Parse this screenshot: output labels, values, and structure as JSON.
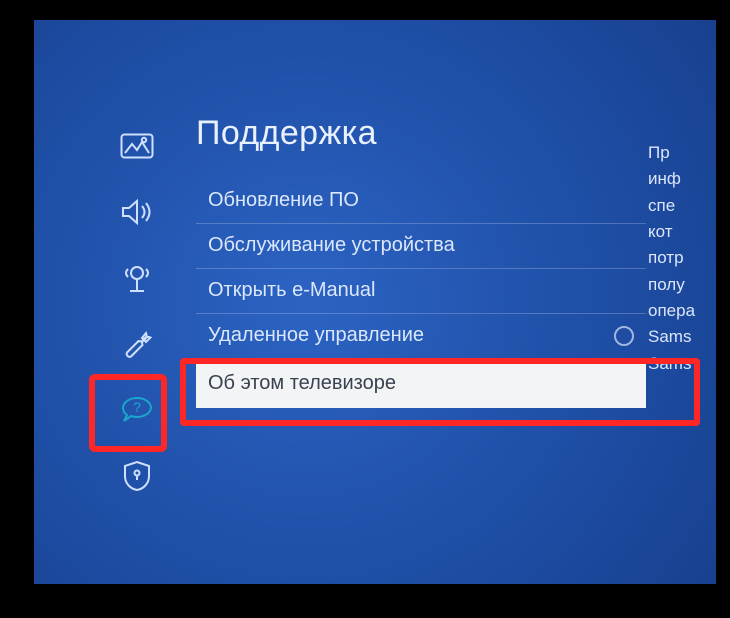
{
  "title": "Поддержка",
  "sidebar": {
    "items": [
      {
        "name": "picture-icon"
      },
      {
        "name": "sound-icon"
      },
      {
        "name": "broadcast-icon"
      },
      {
        "name": "general-icon"
      },
      {
        "name": "support-icon",
        "active": true
      },
      {
        "name": "privacy-icon"
      }
    ]
  },
  "menu": {
    "items": [
      {
        "label": "Обновление ПО"
      },
      {
        "label": "Обслуживание устройства"
      },
      {
        "label": "Открыть e-Manual"
      },
      {
        "label": "Удаленное управление",
        "has_radio": true
      },
      {
        "label": "Об этом телевизоре",
        "selected": true
      }
    ]
  },
  "description": {
    "lines": [
      "Пр",
      "инф",
      "спе",
      "кот",
      "потр",
      "полу",
      "опера",
      "Sams",
      "Sams"
    ]
  }
}
